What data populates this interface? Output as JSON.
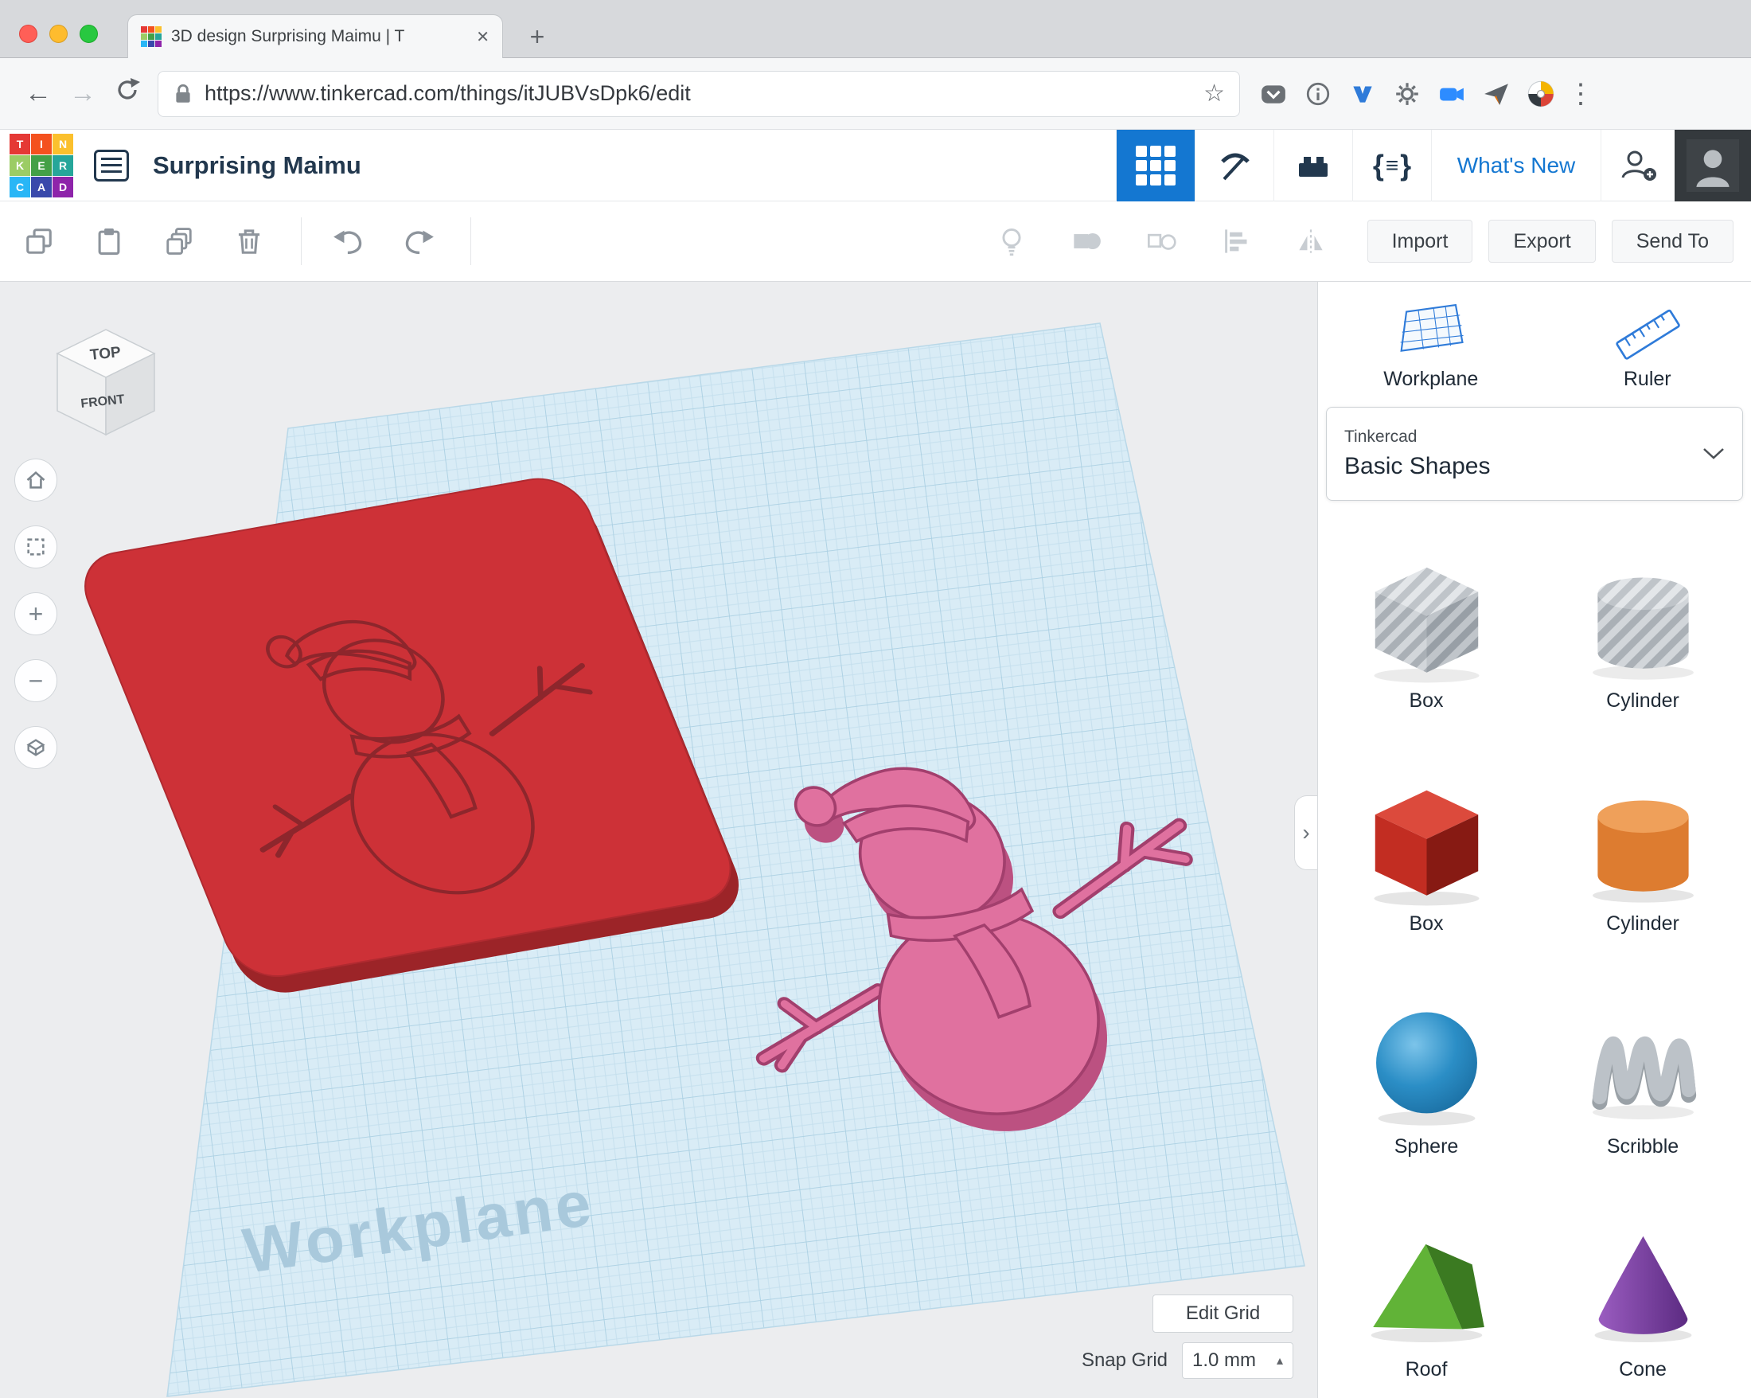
{
  "browser": {
    "tab_title": "3D design Surprising Maimu | T",
    "url": "https://www.tinkercad.com/things/itJUBVsDpk6/edit"
  },
  "icons": {
    "close": "✕",
    "new_tab": "+",
    "back": "←",
    "forward": "→",
    "star": "☆",
    "menu_dots": "⋮",
    "chevron_right": "›",
    "caret_up": "▴",
    "zoom_in": "+",
    "zoom_out": "−",
    "brace_open": "{",
    "bars": "≡",
    "brace_close": "}"
  },
  "header": {
    "logo_letters": [
      "T",
      "I",
      "N",
      "K",
      "E",
      "R",
      "C",
      "A",
      "D"
    ],
    "title": "Surprising Maimu",
    "whats_new": "What's New"
  },
  "toolbar": {
    "import": "Import",
    "export": "Export",
    "send_to": "Send To"
  },
  "canvas": {
    "viewcube_top": "TOP",
    "viewcube_front": "FRONT",
    "watermark": "Workplane",
    "edit_grid": "Edit Grid",
    "snap_grid_label": "Snap Grid",
    "snap_grid_value": "1.0 mm"
  },
  "panel": {
    "workplane_label": "Workplane",
    "ruler_label": "Ruler",
    "category_brand": "Tinkercad",
    "category_selected": "Basic Shapes",
    "shapes": [
      {
        "label": "Box"
      },
      {
        "label": "Cylinder"
      },
      {
        "label": "Box"
      },
      {
        "label": "Cylinder"
      },
      {
        "label": "Sphere"
      },
      {
        "label": "Scribble"
      },
      {
        "label": "Roof"
      },
      {
        "label": "Cone"
      }
    ]
  },
  "colors": {
    "accent_blue": "#1477d1",
    "plate_red": "#cd3137",
    "snowman_pink": "#e0719f",
    "workplane_blue": "#d9ecf6",
    "box_red": "#c22d22",
    "cylinder_orange": "#dd7c30",
    "sphere_blue": "#2b8ec6",
    "roof_green": "#61b337",
    "cone_purple": "#7b3fa0"
  }
}
